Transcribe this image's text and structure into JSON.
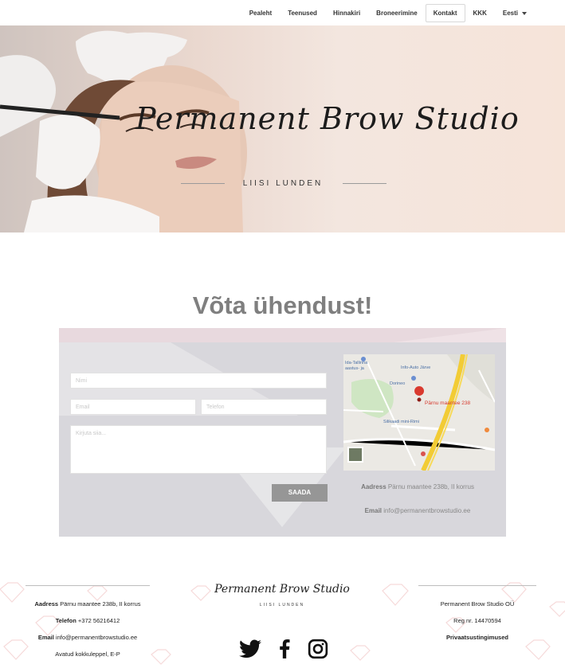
{
  "nav": {
    "items": [
      {
        "label": "Pealeht"
      },
      {
        "label": "Teenused"
      },
      {
        "label": "Hinnakiri"
      },
      {
        "label": "Broneerimine"
      },
      {
        "label": "Kontakt",
        "active": true
      },
      {
        "label": "KKK"
      }
    ],
    "language": "Eesti"
  },
  "hero": {
    "title": "Permanent Brow Studio",
    "subtitle": "LIISI LUNDEN"
  },
  "contact": {
    "heading": "Võta ühendust!",
    "form": {
      "name_placeholder": "Nimi",
      "email_placeholder": "Email",
      "phone_placeholder": "Telefon",
      "message_placeholder": "Kirjuta siia...",
      "submit_label": "SAADA"
    },
    "map": {
      "pin_label": "Pärnu maantee 238",
      "labels": [
        "Ida-Tallinna",
        "aastus- ja",
        "Info-Auto Järve",
        "Dorineo",
        "Silikaadi mini-Rimi"
      ]
    },
    "address_label": "Aadress",
    "address_value": "Pärnu maantee 238b, II korrus",
    "email_label": "Email",
    "email_value": "info@permanentbrowstudio.ee"
  },
  "footer": {
    "left": {
      "address_label": "Aadress",
      "address_value": "Pärnu maantee 238b, II korrus",
      "phone_label": "Telefon",
      "phone_value": "+372 56216412",
      "email_label": "Email",
      "email_value": "info@permanentbrowstudio.ee",
      "hours": "Avatud kokkuleppel, E-P"
    },
    "logo_title": "Permanent Brow Studio",
    "logo_sub": "LIISI LUNDEN",
    "right": {
      "company": "Permanent Brow Studio OÜ",
      "reg": "Reg nr. 14470594",
      "privacy": "Privaatsustingimused"
    },
    "social": [
      "twitter-icon",
      "facebook-icon",
      "instagram-icon"
    ]
  }
}
